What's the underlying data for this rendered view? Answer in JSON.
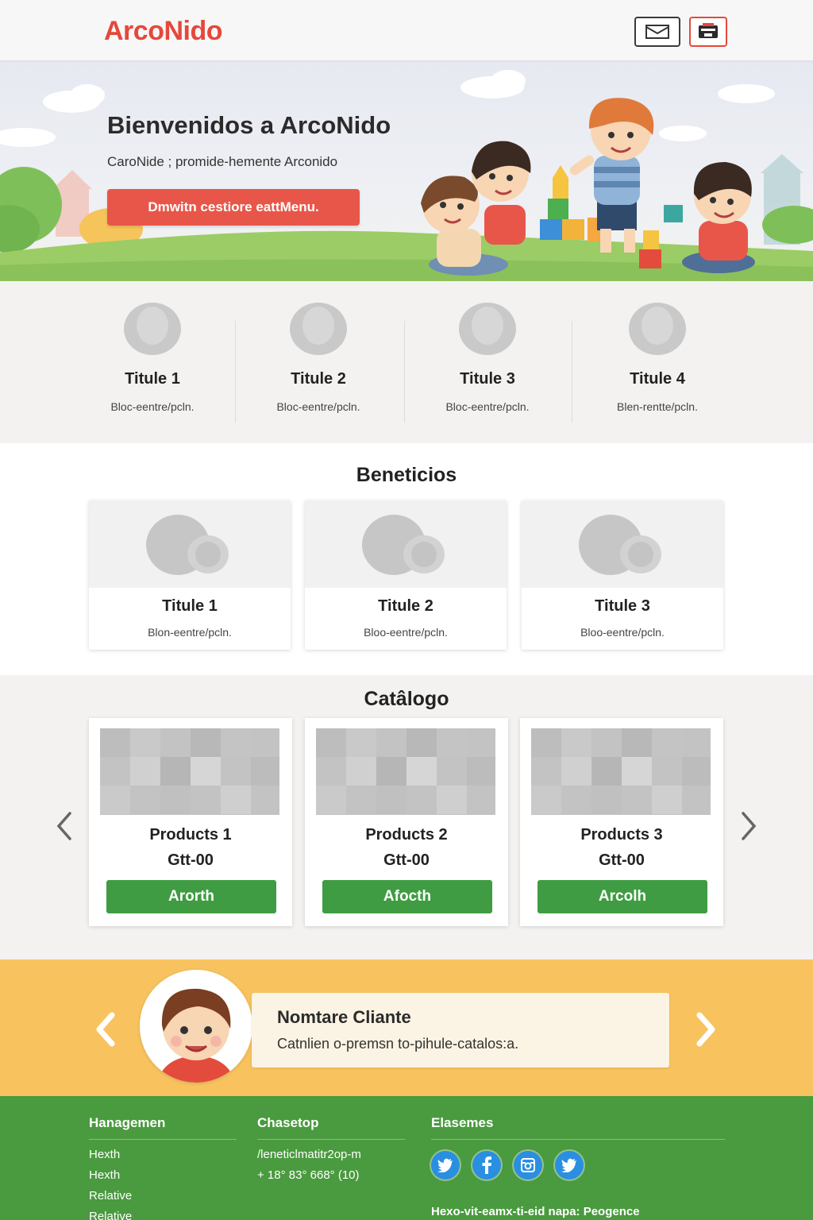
{
  "header": {
    "logo": "ArcoNido",
    "mail_icon": "envelope-icon",
    "cart_icon": "cart-icon"
  },
  "hero": {
    "title": "Bienvenidos a ArcoNido",
    "subtitle": "CaroNide ; promide-hemente Arconido",
    "cta_label": "Dmwitn cestiore eattMenu."
  },
  "features": [
    {
      "title": "Titule 1",
      "desc": "Bloc-eentre/pcln."
    },
    {
      "title": "Titule 2",
      "desc": "Bloc-eentre/pcln."
    },
    {
      "title": "Titule 3",
      "desc": "Bloc-eentre/pcln."
    },
    {
      "title": "Titule 4",
      "desc": "Blen-rentte/pcln."
    }
  ],
  "benefits": {
    "title": "Beneticios",
    "cards": [
      {
        "title": "Titule 1",
        "desc": "Blon-eentre/pcln."
      },
      {
        "title": "Titule 2",
        "desc": "Bloo-eentre/pcln."
      },
      {
        "title": "Titule 3",
        "desc": "Bloo-eentre/pcln."
      }
    ]
  },
  "catalog": {
    "title": "Catâlogo",
    "products": [
      {
        "name": "Products 1",
        "price": "Gtt-00",
        "button": "Arorth"
      },
      {
        "name": "Products 2",
        "price": "Gtt-00",
        "button": "Afocth"
      },
      {
        "name": "Products 3",
        "price": "Gtt-00",
        "button": "Arcolh"
      }
    ]
  },
  "testimonial": {
    "name": "Nomtare Cliante",
    "quote": "Catnlien o-premsn to-pihule-catalos:a."
  },
  "footer": {
    "col1": {
      "title": "Hanagemen",
      "links": [
        "Hexth",
        "Hexth",
        "Relative",
        "Relative"
      ]
    },
    "col2": {
      "title": "Chasetop",
      "lines": [
        "/leneticlmatitr2op-m",
        "+ 18° 83° 668° (10)"
      ]
    },
    "col3": {
      "title": "Elasemes",
      "bottom_text": "Hexo-vit-eamx-ti-eid napa: Peogence"
    },
    "social_icons": [
      "twitter-icon",
      "facebook-icon",
      "instagram-icon",
      "twitter-icon"
    ]
  },
  "colors": {
    "brand_red": "#e5483b",
    "cta_green": "#3f9c42",
    "testimonial_bg": "#f8c35e",
    "footer_green": "#4a9a3f"
  }
}
